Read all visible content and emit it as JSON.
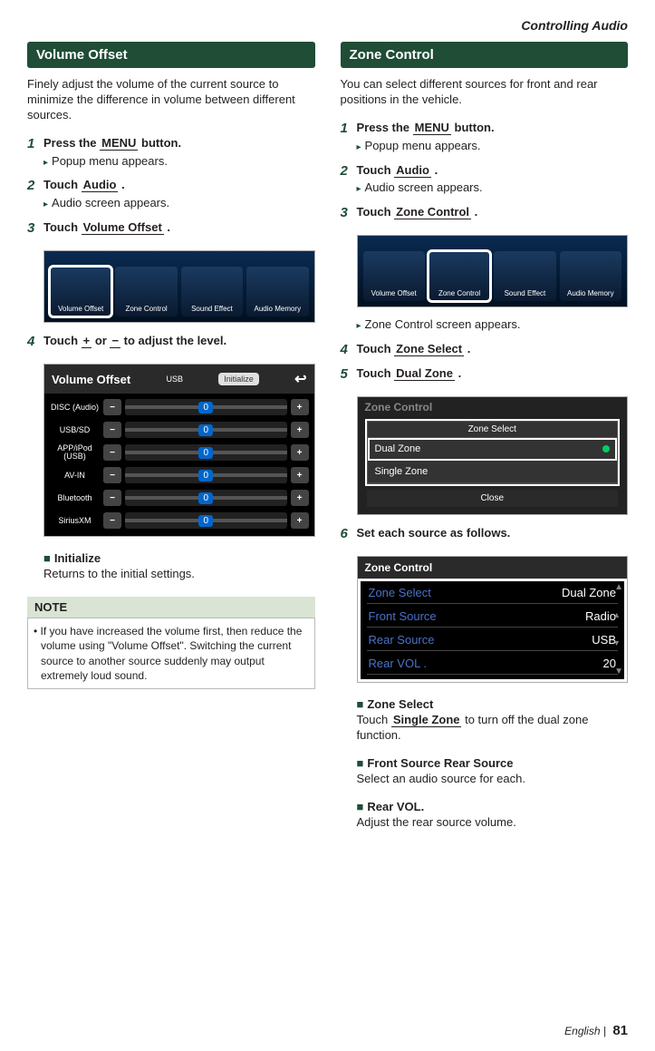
{
  "header": {
    "section": "Controlling Audio"
  },
  "left": {
    "title": "Volume Offset",
    "intro": "Finely adjust the volume of the current source to minimize the difference in volume between different sources.",
    "steps": {
      "s1": {
        "num": "1",
        "t1": "Press the ",
        "btn": "MENU",
        "t2": " button.",
        "r": "Popup menu appears."
      },
      "s2": {
        "num": "2",
        "t1": "Touch ",
        "btn": "Audio",
        "t2": " .",
        "r": "Audio screen appears."
      },
      "s3": {
        "num": "3",
        "t1": "Touch ",
        "btn": "Volume Offset",
        "t2": " ."
      },
      "s4": {
        "num": "4",
        "t1": "Touch ",
        "btn": "+",
        "mid": " or ",
        "btn2": "−",
        "t2": "  to adjust the level."
      }
    },
    "ss_tabs": {
      "a": "Volume Offset",
      "b": "Zone Control",
      "c": "Sound Effect",
      "d": "Audio Memory"
    },
    "ss_vo": {
      "title": "Volume Offset",
      "src": "USB",
      "init": "Initialize",
      "rows": [
        {
          "lbl": "DISC (Audio)",
          "val": "0"
        },
        {
          "lbl": "USB/SD",
          "val": "0"
        },
        {
          "lbl": "APP/iPod (USB)",
          "val": "0"
        },
        {
          "lbl": "AV-IN",
          "val": "0"
        },
        {
          "lbl": "Bluetooth",
          "val": "0"
        },
        {
          "lbl": "SiriusXM",
          "val": "0"
        }
      ]
    },
    "init_title": "Initialize",
    "init_desc": "Returns to the initial settings.",
    "note_label": "NOTE",
    "note_text": "If you have increased the volume first, then reduce the volume using \"Volume Offset\". Switching the current source to another source suddenly may output extremely loud sound."
  },
  "right": {
    "title": "Zone Control",
    "intro": "You can select different sources for front and rear positions in the vehicle.",
    "steps": {
      "s1": {
        "num": "1",
        "t1": "Press the ",
        "btn": "MENU",
        "t2": " button.",
        "r": "Popup menu appears."
      },
      "s2": {
        "num": "2",
        "t1": "Touch ",
        "btn": "Audio",
        "t2": " .",
        "r": "Audio screen appears."
      },
      "s3": {
        "num": "3",
        "t1": "Touch ",
        "btn": "Zone Control",
        "t2": " .",
        "r": "Zone Control screen appears."
      },
      "s4": {
        "num": "4",
        "t1": "Touch ",
        "btn": "Zone Select",
        "t2": " ."
      },
      "s5": {
        "num": "5",
        "t1": "Touch ",
        "btn": "Dual Zone",
        "t2": " ."
      },
      "s6": {
        "num": "6",
        "txt": "Set each source as follows."
      }
    },
    "ss_tabs": {
      "a": "Volume Offset",
      "b": "Zone Control",
      "c": "Sound Effect",
      "d": "Audio Memory"
    },
    "ss_zs": {
      "header": "Zone Control",
      "popup_title": "Zone Select",
      "opt1": "Dual Zone",
      "opt2": "Single Zone",
      "close": "Close"
    },
    "ss_zc": {
      "title": "Zone Control",
      "rows": [
        {
          "k": "Zone Select",
          "v": "Dual Zone"
        },
        {
          "k": "Front Source",
          "v": "Radio"
        },
        {
          "k": "Rear Source",
          "v": "USB"
        },
        {
          "k": "Rear VOL .",
          "v": "20"
        }
      ]
    },
    "zs_title": "Zone Select",
    "zs_desc_t1": "Touch ",
    "zs_desc_btn": "Single Zone",
    "zs_desc_t2": " to turn off the dual zone function.",
    "fs_title": "Front Source",
    "rs_title": "Rear Source",
    "fs_desc": "Select an audio source for each.",
    "rv_title": "Rear VOL.",
    "rv_desc": "Adjust the rear source volume."
  },
  "footer": {
    "lang": "English",
    "page": "81"
  }
}
